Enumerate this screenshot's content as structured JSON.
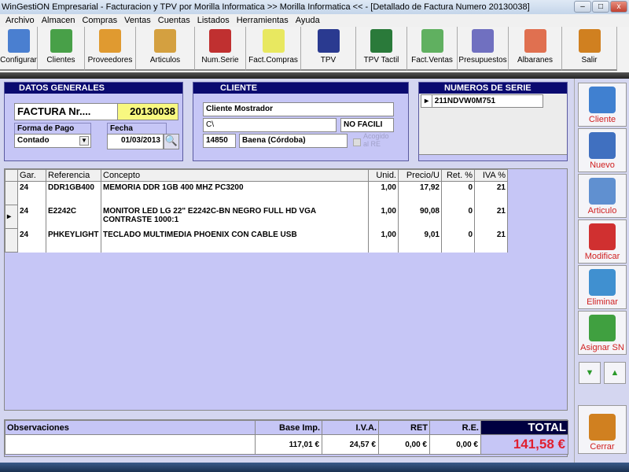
{
  "window": {
    "title": "WinGestiON Empresarial - Facturacion y TPV por Morilla Informatica >> Morilla Informatica << - [Detallado de Factura Numero 20130038]"
  },
  "menu": [
    "Archivo",
    "Almacen",
    "Compras",
    "Ventas",
    "Cuentas",
    "Listados",
    "Herramientas",
    "Ayuda"
  ],
  "toolbar": [
    {
      "label": "Configurar",
      "icon": "gear-icon",
      "color": "#4a7fd0",
      "w": 48
    },
    {
      "label": "Clientes",
      "icon": "client-icon",
      "color": "#48a048",
      "w": 60
    },
    {
      "label": "Proveedores",
      "icon": "supplier-icon",
      "color": "#e09a30",
      "w": 65
    },
    {
      "label": "Articulos",
      "icon": "clipboard-icon",
      "color": "#d4a040",
      "w": 75
    },
    {
      "label": "Num.Serie",
      "icon": "barcode-icon",
      "color": "#c03030",
      "w": 65
    },
    {
      "label": "Fact.Compras",
      "icon": "invoice-icon",
      "color": "#e8e860",
      "w": 70
    },
    {
      "label": "TPV",
      "icon": "pos-terminal-icon",
      "color": "#2a3a90",
      "w": 70
    },
    {
      "label": "TPV Tactil",
      "icon": "pos-terminal-icon",
      "color": "#2a7a3a",
      "w": 65
    },
    {
      "label": "Fact.Ventas",
      "icon": "invoice-icon",
      "color": "#60b060",
      "w": 64
    },
    {
      "label": "Presupuestos",
      "icon": "invoice-icon",
      "color": "#7070c0",
      "w": 65
    },
    {
      "label": "Albaranes",
      "icon": "invoice-icon",
      "color": "#e07050",
      "w": 68
    },
    {
      "label": "Salir",
      "icon": "exit-door-icon",
      "color": "#d08020",
      "w": 70
    }
  ],
  "datos": {
    "header": "DATOS GENERALES",
    "factura_label": "FACTURA Nr....",
    "factura_num": "20130038",
    "forma_pago_label": "Forma de Pago",
    "forma_pago": "Contado",
    "fecha_label": "Fecha",
    "fecha": "01/03/2013"
  },
  "cliente": {
    "header": "CLIENTE",
    "nombre": "Cliente Mostrador",
    "direccion": "C\\",
    "nif": "NO FACILI",
    "cp": "14850",
    "poblacion": "Baena (Córdoba)",
    "re_label": "Acogido al RE"
  },
  "series": {
    "header": "NUMEROS DE SERIE",
    "items": [
      "211NDVW0M751"
    ]
  },
  "grid": {
    "columns": [
      "Gar.",
      "Referencia",
      "Concepto",
      "Unid.",
      "Precio/U",
      "Ret. %",
      "IVA %"
    ],
    "rows": [
      [
        "24",
        "DDR1GB400",
        "MEMORIA DDR 1GB 400 MHZ PC3200",
        "1,00",
        "17,92",
        "0",
        "21"
      ],
      [
        "24",
        "E2242C",
        "MONITOR LED LG 22\" E2242C-BN NEGRO FULL HD VGA CONTRASTE 1000:1",
        "1,00",
        "90,08",
        "0",
        "21"
      ],
      [
        "24",
        "PHKEYLIGHT",
        "TECLADO MULTIMEDIA PHOENIX CON CABLE USB",
        "1,00",
        "9,01",
        "0",
        "21"
      ]
    ],
    "selected_row": 1
  },
  "totals": {
    "obs_label": "Observaciones",
    "base_label": "Base Imp.",
    "iva_label": "I.V.A.",
    "ret_label": "RET",
    "re_label": "R.E.",
    "total_label": "TOTAL",
    "base": "117,01 €",
    "iva": "24,57 €",
    "ret": "0,00 €",
    "re": "0,00 €",
    "total": "141,58 €"
  },
  "side": [
    {
      "label": "Cliente",
      "icon": "search-client-icon",
      "color": "#4080d0"
    },
    {
      "label": "Nuevo",
      "icon": "new-pencil-icon",
      "color": "#4070c0"
    },
    {
      "label": "Articulo",
      "icon": "search-article-icon",
      "color": "#6090d0"
    },
    {
      "label": "Modificar",
      "icon": "modify-x-icon",
      "color": "#d03030"
    },
    {
      "label": "Eliminar",
      "icon": "trash-icon",
      "color": "#4090d0"
    },
    {
      "label": "Asignar SN",
      "icon": "barcode-icon",
      "color": "#40a040"
    }
  ],
  "close_label": "Cerrar"
}
